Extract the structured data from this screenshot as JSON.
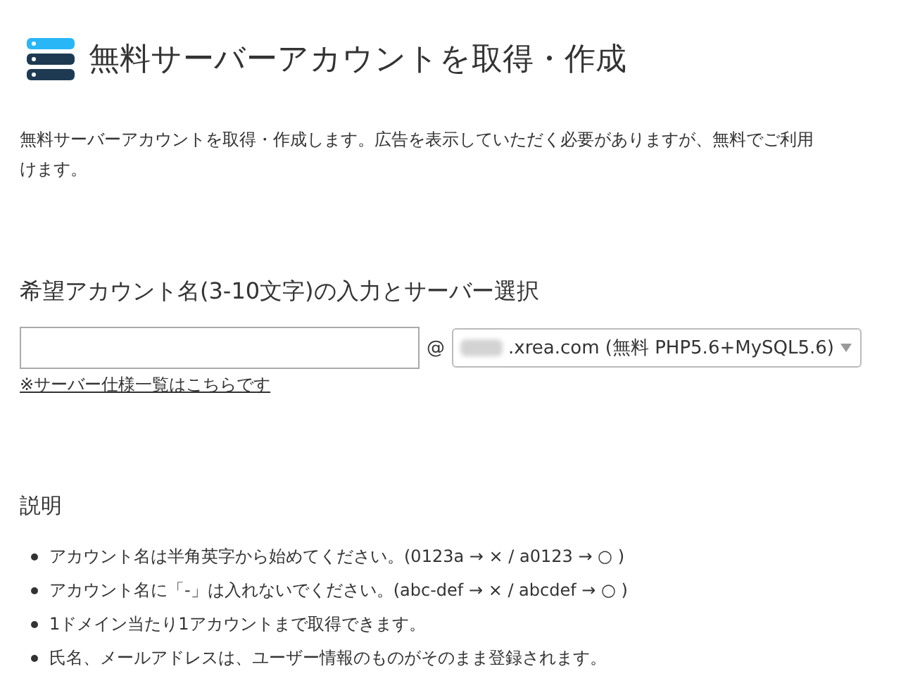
{
  "title": "無料サーバーアカウントを取得・作成",
  "intro": [
    "無料サーバーアカウントを取得・作成します。広告を表示していただく必要がありますが、無料でご利用",
    "けます。"
  ],
  "form": {
    "heading": "希望アカウント名(3-10文字)の入力とサーバー選択",
    "at": "@",
    "server_select": ".xrea.com (無料 PHP5.6+MySQL5.6)",
    "spec_link": "※サーバー仕様一覧はこちらです"
  },
  "notes": {
    "heading": "説明",
    "items": [
      "アカウント名は半角英字から始めてください。(0123a → × / a0123 → ○ )",
      "アカウント名に「-」は入れないでください。(abc-def → × / abcdef → ○ )",
      "1ドメイン当たり1アカウントまで取得できます。",
      "氏名、メールアドレスは、ユーザー情報のものがそのまま登録されます。"
    ]
  }
}
